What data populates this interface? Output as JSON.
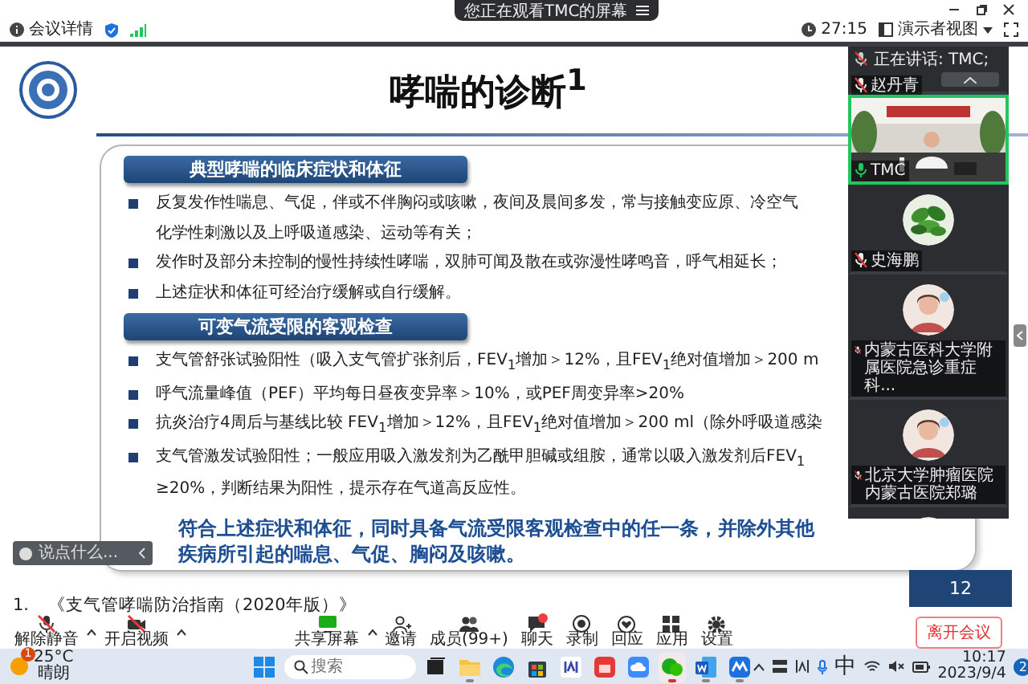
{
  "screen_share_banner": {
    "text": "您正在观看TMC的屏幕"
  },
  "meeting_bar": {
    "info_label": "会议详情",
    "timer": "27:15",
    "view_mode": "演示者视图"
  },
  "slide": {
    "title": "哮喘的诊断$^{1}$",
    "sections": [
      {
        "heading": "典型哮喘的临床症状和体征",
        "bullets": [
          {
            "lines": [
              "反复发作性喘息、气促，伴或不伴胸闷或咳嗽，夜间及晨间多发，常与接触变应原、冷空气",
              "化学性刺激以及上呼吸道感染、运动等有关；"
            ]
          },
          {
            "lines": [
              "发作时及部分未控制的慢性持续性哮喘，双肺可闻及散在或弥漫性哮鸣音，呼气相延长；"
            ]
          },
          {
            "lines": [
              "上述症状和体征可经治疗缓解或自行缓解。"
            ]
          }
        ]
      },
      {
        "heading": "可变气流受限的客观检查",
        "bullets": [
          {
            "lines": [
              "支气管舒张试验阳性（吸入支气管扩张剂后，FEV$_{1}$增加＞12%，且FEV$_{1}$绝对值增加＞200 m"
            ]
          },
          {
            "lines": [
              "呼气流量峰值（PEF）平均每日昼夜变异率＞10%，或PEF周变异率>20%"
            ]
          },
          {
            "lines": [
              "抗炎治疗4周后与基线比较 FEV$_{1}$增加＞12%，且FEV$_{1}$绝对值增加＞200 ml（除外呼吸道感染"
            ]
          },
          {
            "lines": [
              "支气管激发试验阳性；一般应用吸入激发剂为乙酰甲胆碱或组胺，通常以吸入激发剂后FEV$_{1}$",
              "≥20%，判断结果为阳性，提示存在气道高反应性。"
            ]
          }
        ]
      }
    ],
    "conclusion": "符合上述症状和体征，同时具备气流受限客观检查中的任一条，并除外其他疾病所引起的喘息、气促、胸闷及咳嗽。",
    "reference_number": "1.",
    "reference": "《支气管哮喘防治指南（2020年版）》",
    "page_number": "12"
  },
  "chat_input": {
    "placeholder": "说点什么..."
  },
  "participants_panel": {
    "speaking": "正在讲话: TMC;",
    "tiles": [
      {
        "kind": "label",
        "name": "赵丹青",
        "muted": true,
        "speaking": false
      },
      {
        "kind": "video",
        "name": "TMC",
        "muted": false,
        "speaking": true
      },
      {
        "kind": "plant",
        "name": "史海鹏",
        "muted": true,
        "speaking": false
      },
      {
        "kind": "person",
        "name": "内蒙古医科大学附属医院急诊重症科...",
        "muted": true,
        "speaking": false
      },
      {
        "kind": "person",
        "name": "北京大学肿瘤医院内蒙古医院郑璐",
        "muted": true,
        "speaking": false
      },
      {
        "kind": "person",
        "speaking": false
      }
    ]
  },
  "toolbar": {
    "controls": [
      {
        "kind": "mic",
        "label": "解除静音",
        "off": true,
        "has_menu": true,
        "unread": false
      },
      {
        "kind": "camera",
        "label": "开启视频",
        "off": true,
        "has_menu": true,
        "unread": false
      },
      {
        "kind": "share",
        "label": "共享屏幕",
        "off": false,
        "has_menu": true,
        "unread": false
      },
      {
        "kind": "invite",
        "label": "邀请",
        "off": false,
        "has_menu": false,
        "unread": false
      },
      {
        "kind": "members",
        "label": "成员(99+)",
        "off": false,
        "has_menu": false,
        "unread": false
      },
      {
        "kind": "chat",
        "label": "聊天",
        "off": false,
        "has_menu": false,
        "unread": true
      },
      {
        "kind": "record",
        "label": "录制",
        "off": false,
        "has_menu": false,
        "unread": false
      },
      {
        "kind": "react",
        "label": "回应",
        "off": false,
        "has_menu": false,
        "unread": false
      },
      {
        "kind": "apps",
        "label": "应用",
        "off": false,
        "has_menu": false,
        "unread": false
      },
      {
        "kind": "settings",
        "label": "设置",
        "off": false,
        "has_menu": false,
        "unread": false
      }
    ],
    "leave_button": "离开会议"
  },
  "taskbar": {
    "weather": {
      "temperature": "25°C",
      "condition": "晴朗",
      "badge": "1"
    },
    "search": {
      "placeholder": "搜索"
    },
    "apps": [
      {
        "kind": "start",
        "running": false,
        "active": false
      },
      {
        "kind": "taskview",
        "running": false,
        "active": false
      },
      {
        "kind": "folder",
        "running": true,
        "active": false
      },
      {
        "kind": "browser",
        "running": false,
        "active": false
      },
      {
        "kind": "store",
        "running": false,
        "active": false
      },
      {
        "kind": "bracket",
        "running": false,
        "active": false
      },
      {
        "kind": "redapp",
        "running": false,
        "active": false
      },
      {
        "kind": "cloud",
        "running": false,
        "active": false
      },
      {
        "kind": "chatapp",
        "running": true,
        "active": true
      },
      {
        "kind": "document",
        "running": true,
        "active": false
      },
      {
        "kind": "meeting",
        "running": true,
        "active": false
      }
    ],
    "ime": "中",
    "time": "10:17",
    "date": "2023/9/4",
    "notifications": "2"
  }
}
